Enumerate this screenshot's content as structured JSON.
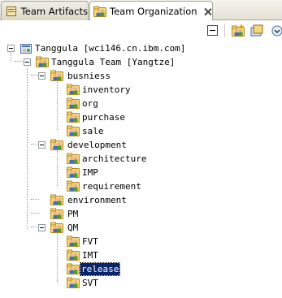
{
  "tabs": [
    {
      "label": "Team Artifacts",
      "active": false
    },
    {
      "label": "Team Organization",
      "active": true
    }
  ],
  "toolbar": {
    "buttons": [
      "collapse-all-icon",
      "create-team-icon",
      "create-project-icon",
      "menu-icon"
    ]
  },
  "tree": {
    "root": "Tanggula [wci146.cn.ibm.com]",
    "team": "Tanggula Team [Yangtze]",
    "nodes": {
      "busniess": "busniess",
      "inventory": "inventory",
      "org": "org",
      "purchase": "purchase",
      "sale": "sale",
      "development": "development",
      "architecture": "architecture",
      "imp": "IMP",
      "requirement": "requirement",
      "environment": "environment",
      "pm": "PM",
      "qm": "QM",
      "fvt": "FVT",
      "imt": "IMT",
      "release": "release",
      "svt": "SVT"
    },
    "selected": "release"
  },
  "colors": {
    "selection": "#0a246a",
    "folder": "#e8c45c",
    "person_blue": "#3b6fc4",
    "person_green": "#4e9a3a"
  }
}
